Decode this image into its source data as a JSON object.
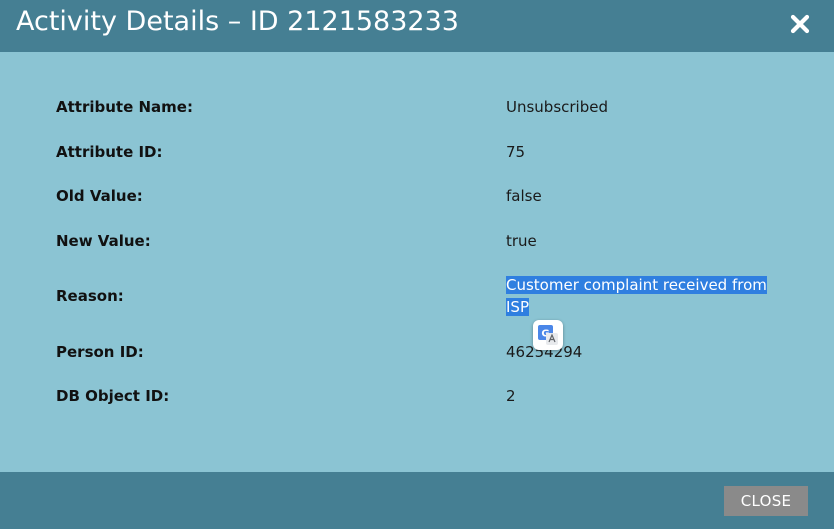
{
  "dialog": {
    "title": "Activity Details – ID 2121583233",
    "close_icon": "close-x-icon"
  },
  "details": [
    {
      "label": "Attribute Name:",
      "value": "Unsubscribed"
    },
    {
      "label": "Attribute ID:",
      "value": "75"
    },
    {
      "label": "Old Value:",
      "value": "false"
    },
    {
      "label": "New Value:",
      "value": "true"
    },
    {
      "label": "Reason:",
      "value": "Customer complaint received from ISP"
    },
    {
      "label": "Person ID:",
      "value": "46254294"
    },
    {
      "label": "DB Object ID:",
      "value": "2"
    }
  ],
  "overlay": {
    "translate_icon": "google-translate-icon"
  },
  "footer": {
    "close_label": "CLOSE"
  },
  "colors": {
    "header_bg": "#457f93",
    "body_bg": "#8bc4d3",
    "selection": "#2f7fe0",
    "button_bg": "#8a8a8a"
  }
}
